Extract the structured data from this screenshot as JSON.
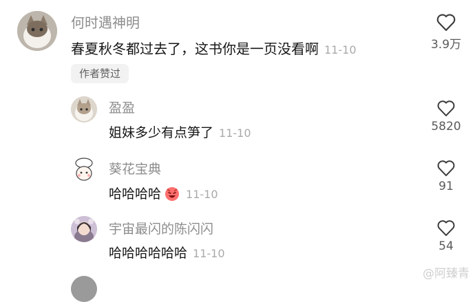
{
  "comments": [
    {
      "user": "何时遇神明",
      "text": "春夏秋冬都过去了，这书你是一页没看啊",
      "date": "11-10",
      "likes": "3.9万",
      "badge": "作者赞过",
      "avatar": "cat-avatar"
    },
    {
      "user": "盈盈",
      "text": "姐妹多少有点笋了",
      "date": "11-10",
      "likes": "5820",
      "avatar": "cat-avatar"
    },
    {
      "user": "葵花宝典",
      "text": "哈哈哈哈",
      "date": "11-10",
      "likes": "91",
      "avatar": "cartoon-chef-avatar",
      "emoji": "laughing-emoji"
    },
    {
      "user": "宇宙最闪的陈闪闪",
      "text": "哈哈哈哈哈哈",
      "date": "11-10",
      "likes": "54",
      "avatar": "girl-avatar"
    }
  ],
  "watermark": "@阿臻青",
  "colors": {
    "name": "#8d8d8d",
    "text": "#161616",
    "date": "#a9a9a9",
    "badge_bg": "#f2f2f2"
  }
}
